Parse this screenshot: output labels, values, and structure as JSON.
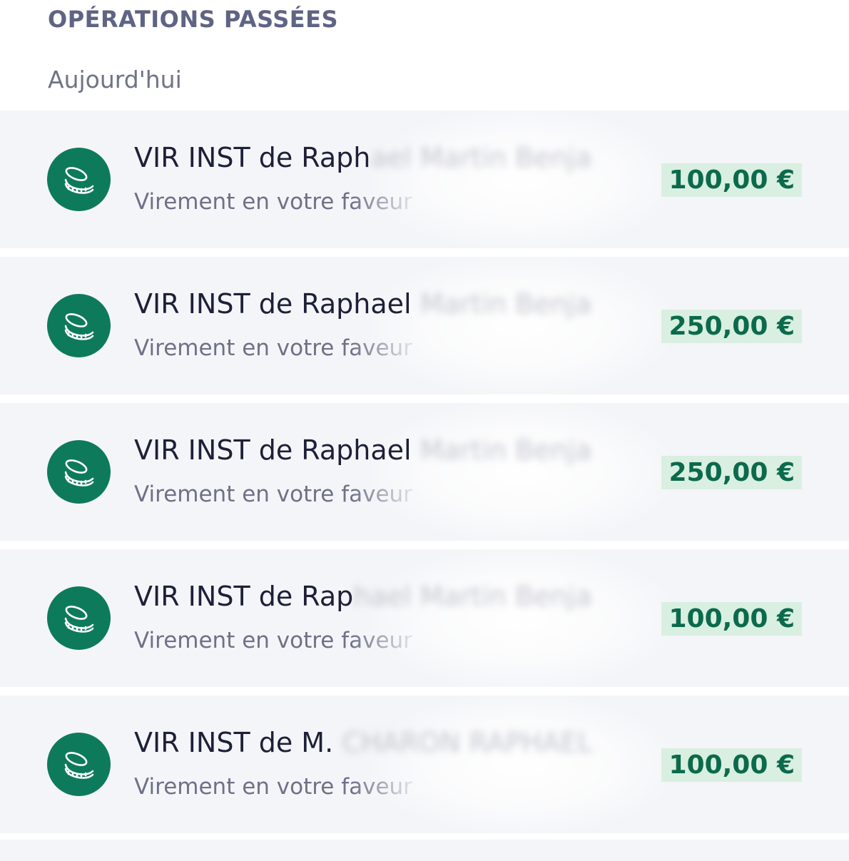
{
  "section_title": "OPÉRATIONS PASSÉES",
  "date_group": "Aujourd'hui",
  "colors": {
    "icon_bg": "#0e7a5c",
    "amount_bg": "#d9efe1",
    "amount_text": "#0c6a4c",
    "row_bg": "#f4f5f8"
  },
  "icon": "coins-icon",
  "transactions": [
    {
      "title_visible": "VIR INST de Raph",
      "title_hidden": "ael Martin Benja",
      "subtitle": "Virement en votre faveur",
      "amount": "100,00 €"
    },
    {
      "title_visible": "VIR INST de Raphael",
      "title_hidden": "Martin Benja",
      "subtitle": "Virement en votre faveur",
      "amount": "250,00 €"
    },
    {
      "title_visible": "VIR INST de Raphael",
      "title_hidden": "Martin Benja",
      "subtitle": "Virement en votre faveur",
      "amount": "250,00 €"
    },
    {
      "title_visible": "VIR INST de Rap",
      "title_hidden": "hael Martin Benja",
      "subtitle": "Virement en votre faveur",
      "amount": "100,00 €"
    },
    {
      "title_visible": "VIR INST de M.",
      "title_hidden": "CHARON RAPHAEL",
      "subtitle": "Virement en votre faveur",
      "amount": "100,00 €"
    }
  ]
}
